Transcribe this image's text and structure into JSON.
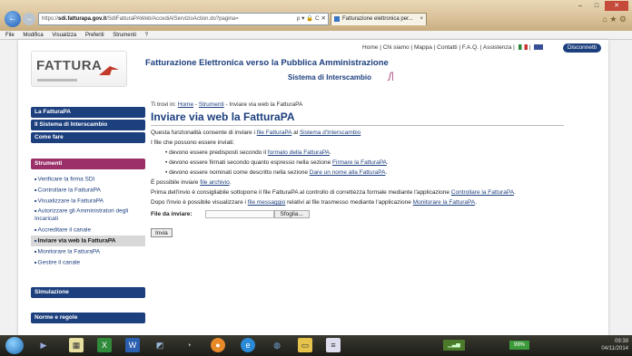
{
  "browser": {
    "address_prefix": "https://",
    "address_host": "sdi.fatturapa.gov.it",
    "address_rest": "/SdIFatturaPAWeb/AccediAlServizioAction.do?pagina=",
    "address_tools": "ρ ▾ 🔒 C ✕",
    "tab_label": "Fatturazione elettronica per...",
    "tab_close": "×",
    "win_min": "–",
    "win_max": "□",
    "win_close": "✕",
    "chrome_icons": "⌂ ★ ⚙",
    "back": "←",
    "forward": "→"
  },
  "menu": [
    "File",
    "Modifica",
    "Visualizza",
    "Preferiti",
    "Strumenti",
    "?"
  ],
  "header": {
    "logo": "FATTURA",
    "toplinks": [
      "Home",
      "Chi siamo",
      "Mappa",
      "Contatti",
      "F.A.Q.",
      "Assistenza"
    ],
    "separator": "|",
    "logout": "Disconnetti",
    "title": "Fatturazione Elettronica verso la Pubblica Amministrazione",
    "subtitle": "Sistema di Interscambio",
    "sdi_glyph": "ʃ|"
  },
  "sidebar": {
    "top_buttons": [
      "La FatturaPA",
      "Il Sistema di Interscambio",
      "Come fare"
    ],
    "section": "Strumenti",
    "items": [
      "Verificare la firma SDI",
      "Controllare la FatturaPA",
      "Visualizzare la FatturaPA",
      "Autorizzare gli Amministratori degli Incaricati",
      "Accreditare il canale",
      "Inviare via web la FatturaPA",
      "Monitorare la FatturaPA",
      "Gestire il canale"
    ],
    "bottom_buttons": [
      "Simulazione",
      "Norme e regole"
    ]
  },
  "main": {
    "breadcrumb": {
      "prefix": "Ti trovi in: ",
      "home": "Home",
      "sep": " - ",
      "tools": "Strumenti",
      "current": "Inviare via web la FatturaPA"
    },
    "title": "Inviare via web la FatturaPA",
    "intro_a": "Questa funzionalità consente di inviare i ",
    "intro_link1": "file FatturaPA",
    "intro_b": " al ",
    "intro_link2": "Sistema d'Interscambio",
    "files_label": "I file che possono essere inviati:",
    "bullet1_text": "devono essere predisposti secondo il ",
    "bullet1_link": "formato della FatturaPA",
    "bullet2_text": "devono essere firmati secondo quanto espresso nella sezione ",
    "bullet2_link": "Firmare la FatturaPA",
    "bullet3_text": "devono essere nominati come descritto nella sezione ",
    "bullet3_link": "Dare un nome alla FatturaPA",
    "archive_text": "È possibile inviare ",
    "archive_link": "file archivio",
    "advice_text": "Prima dell'invio è consigliabile sottoporre il file FatturaPA al controllo di correttezza formale mediante l'applicazione ",
    "advice_link": "Controllare la FatturaPA",
    "after_a": "Dopo l'invio è possibile visualizzare i ",
    "after_link1": "file messaggio",
    "after_b": " relativi al file trasmesso mediante l'applicazione ",
    "after_link2": "Monitorare la FatturaPA",
    "dot": ".",
    "file_label": "File da inviare:",
    "browse": "Sfoglia...",
    "submit": "Invia"
  },
  "taskbar": {
    "time": "09:39",
    "date": "04/11/2014",
    "battery": "99%",
    "signal": "▁▃▅"
  }
}
